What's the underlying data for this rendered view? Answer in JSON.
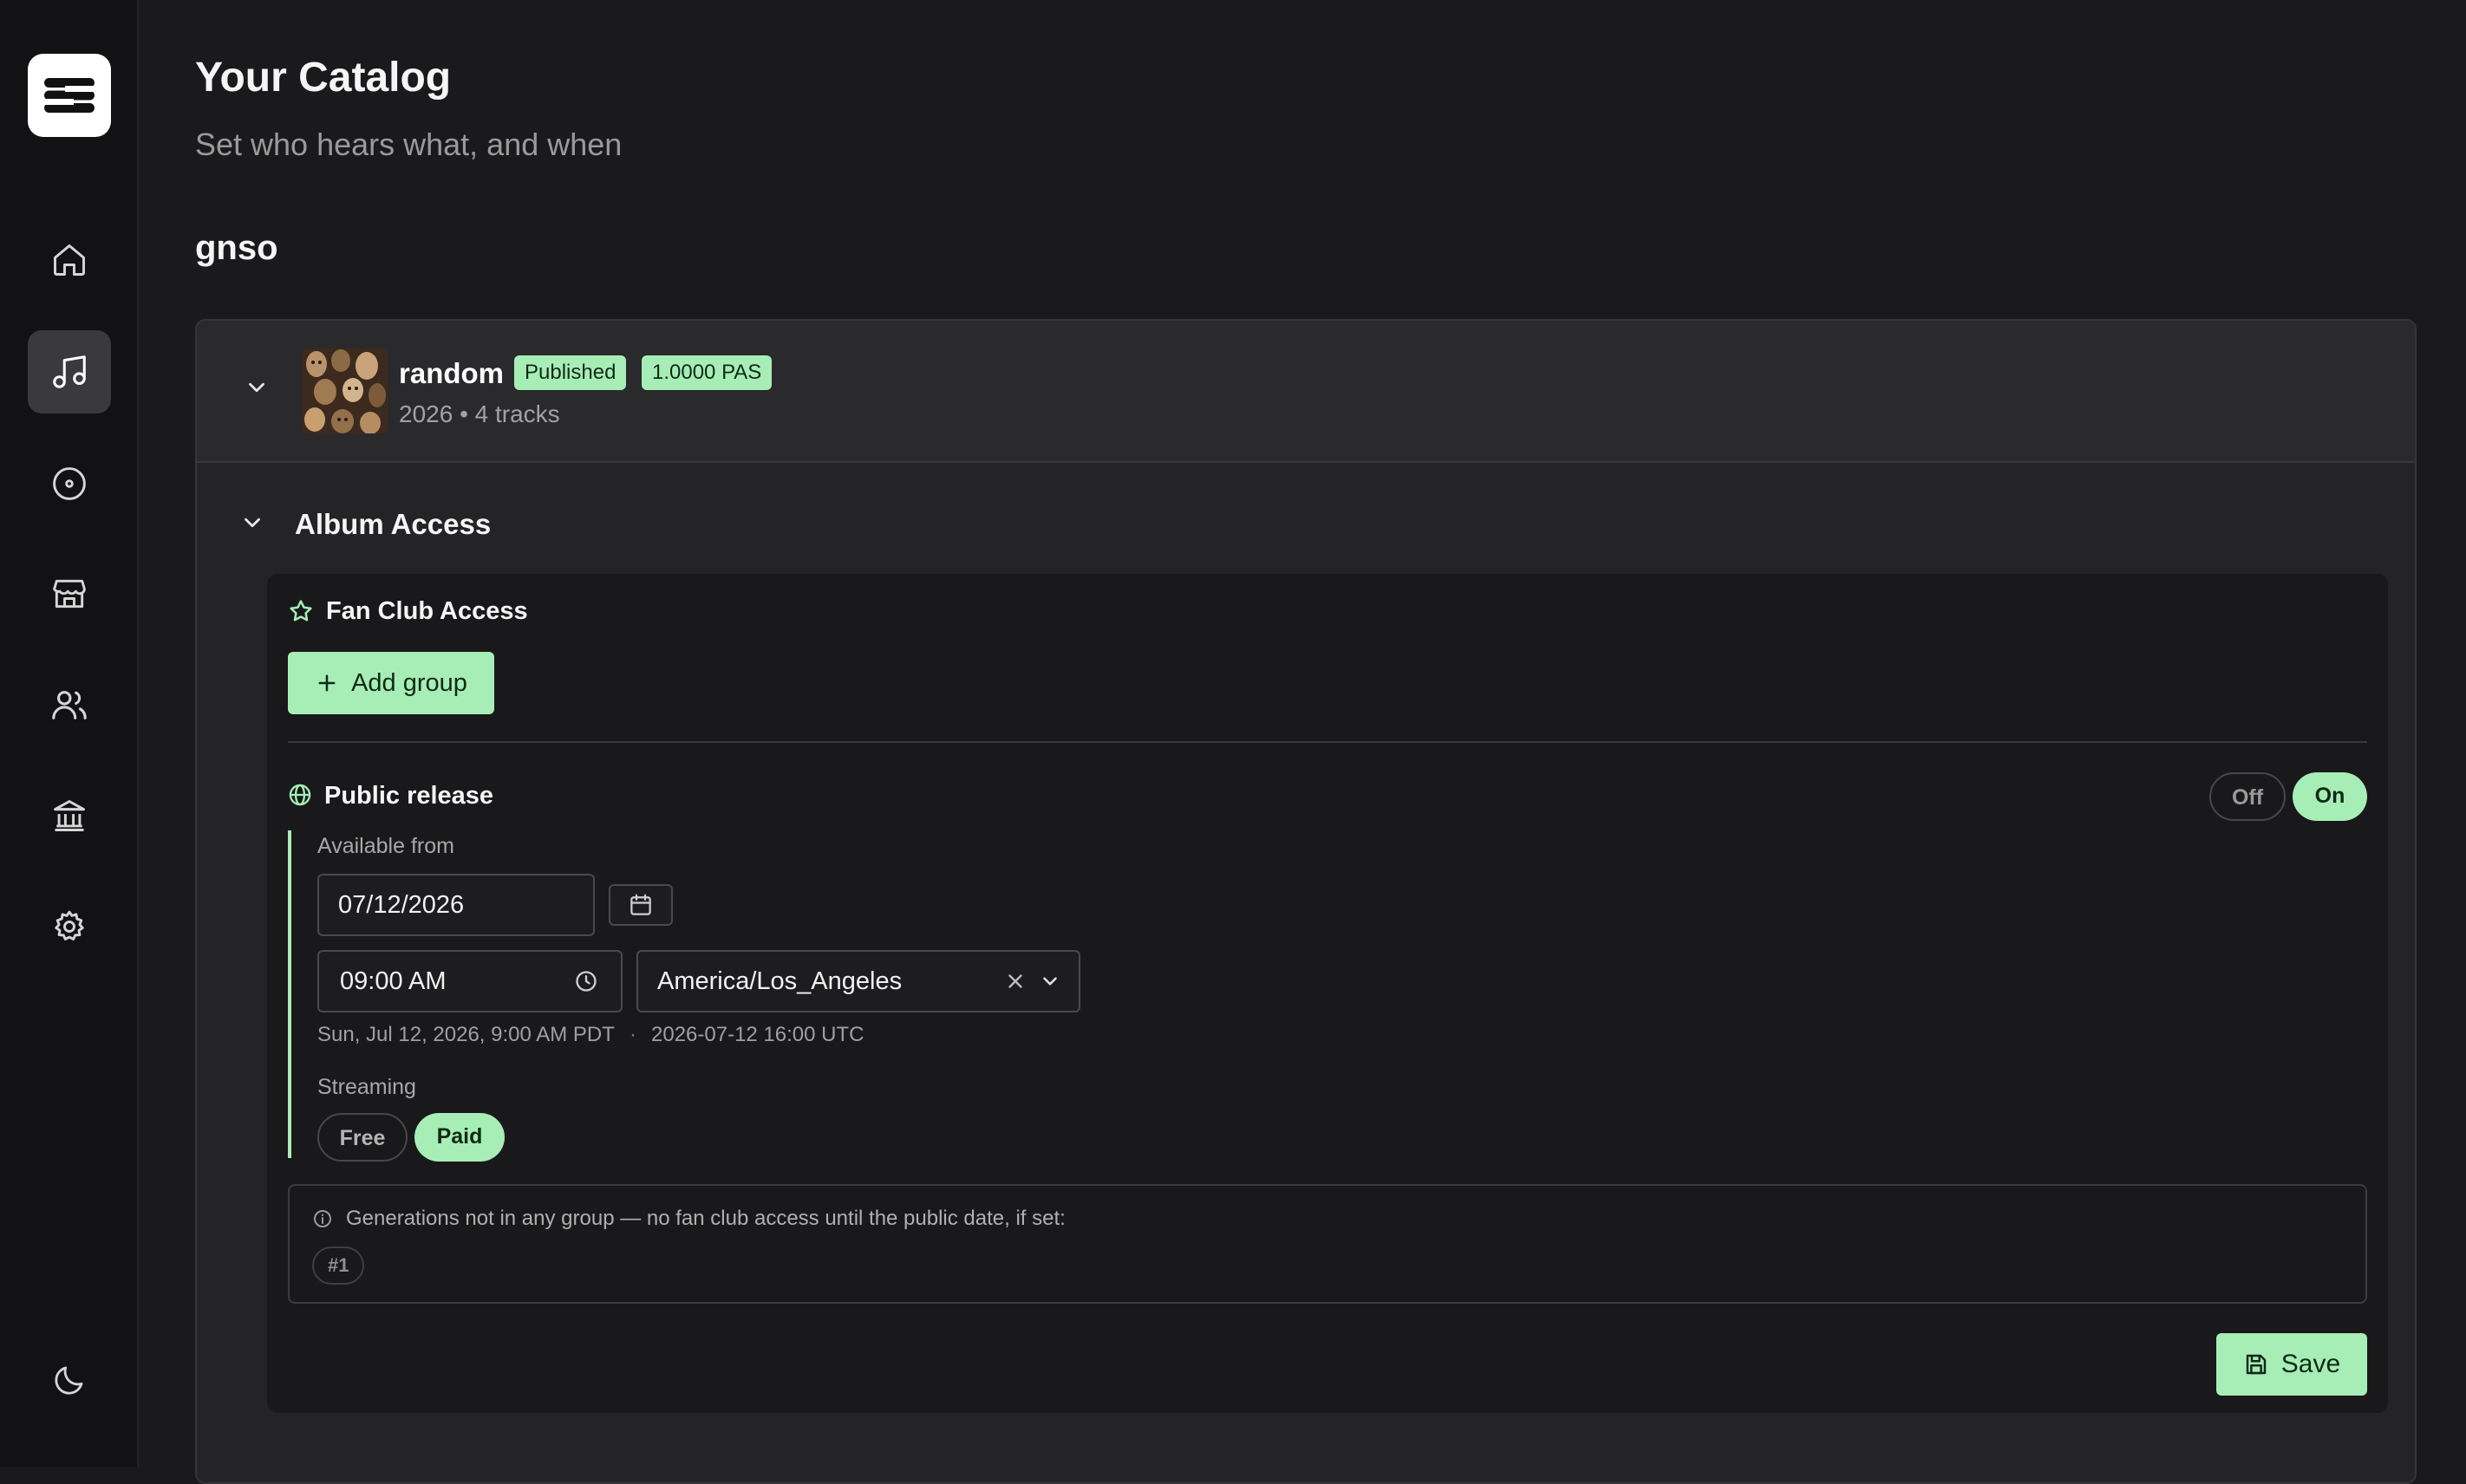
{
  "sidebar": {
    "items": [
      {
        "icon": "home-icon"
      },
      {
        "icon": "music-note-icon",
        "active": true
      },
      {
        "icon": "disc-icon"
      },
      {
        "icon": "store-icon"
      },
      {
        "icon": "users-icon"
      },
      {
        "icon": "bank-icon"
      },
      {
        "icon": "gear-icon"
      }
    ],
    "theme_icon": "moon-icon"
  },
  "header": {
    "title": "Your Catalog",
    "subtitle": "Set who hears what, and when"
  },
  "artist": {
    "name": "gnso"
  },
  "album": {
    "title": "random",
    "status_badge": "Published",
    "price_badge": "1.0000 PAS",
    "meta": "2026 • 4 tracks"
  },
  "album_access": {
    "title": "Album Access",
    "fan_club": {
      "title": "Fan Club Access",
      "add_group_label": "Add group"
    },
    "public_release": {
      "title": "Public release",
      "toggle_off": "Off",
      "toggle_on": "On",
      "available_from_label": "Available from",
      "date_value": "07/12/2026",
      "time_value": "09:00 AM",
      "timezone_value": "America/Los_Angeles",
      "local_summary": "Sun, Jul 12, 2026, 9:00 AM PDT",
      "separator": "·",
      "utc_summary": "2026-07-12 16:00 UTC",
      "streaming_label": "Streaming",
      "streaming_free": "Free",
      "streaming_paid": "Paid"
    },
    "info": {
      "text": "Generations not in any group — no fan club access until the public date, if set:",
      "chips": [
        "#1"
      ]
    },
    "save_label": "Save"
  },
  "colors": {
    "accent": "#a7eeb6",
    "background": "#1a1a1c",
    "sidebar": "#121214"
  }
}
